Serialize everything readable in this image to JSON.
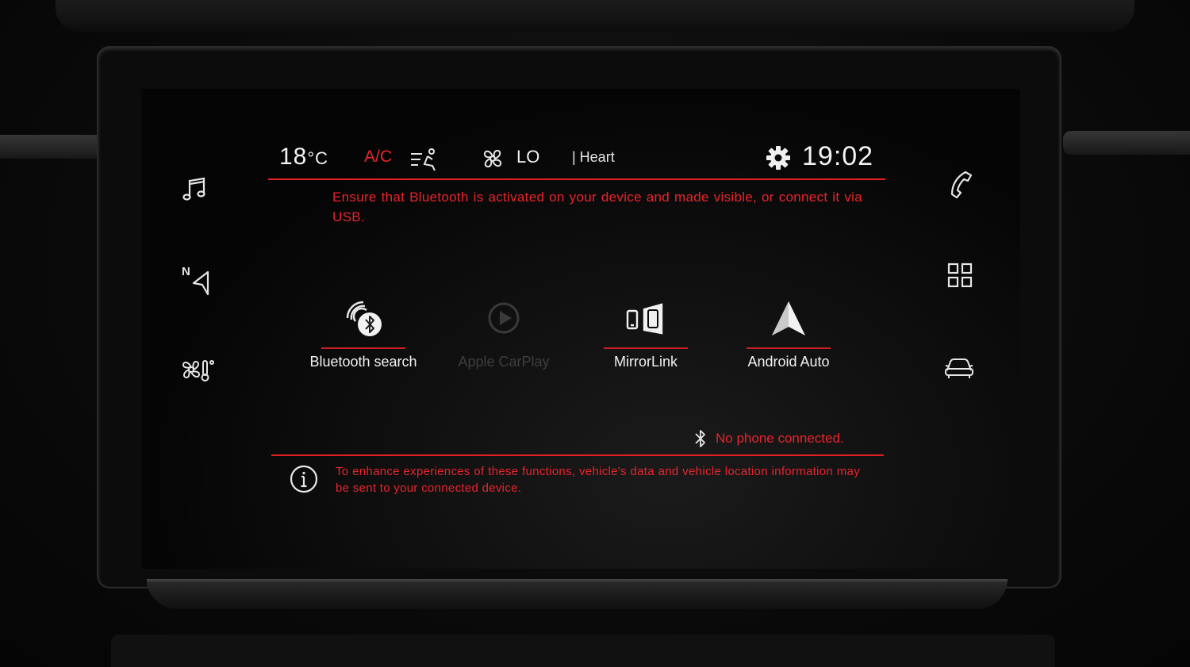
{
  "status_bar": {
    "temperature": "18",
    "temperature_unit": "°C",
    "ac_label": "A/C",
    "fan_level": "LO",
    "radio_station": "| Heart",
    "clock": "19:02"
  },
  "message": {
    "top_warning": "Ensure that Bluetooth is activated on your device and made visible, or connect it via USB.",
    "connection_status": "No phone connected.",
    "info_text": "To enhance experiences of these functions, vehicle's data and vehicle location information may be sent to your connected device."
  },
  "tiles": [
    {
      "label": "Bluetooth search",
      "enabled": true
    },
    {
      "label": "Apple CarPlay",
      "enabled": false
    },
    {
      "label": "MirrorLink",
      "enabled": true
    },
    {
      "label": "Android Auto",
      "enabled": true
    }
  ],
  "left_nav": [
    {
      "icon": "music-note-icon"
    },
    {
      "icon": "navigation-icon",
      "text": "N"
    },
    {
      "icon": "climate-icon"
    }
  ],
  "right_nav": [
    {
      "icon": "phone-icon"
    },
    {
      "icon": "apps-grid-icon"
    },
    {
      "icon": "car-icon"
    }
  ],
  "colors": {
    "accent_red": "#e21e26",
    "text_white": "#f2f2f2",
    "disabled_grey": "#3e3e3e"
  }
}
